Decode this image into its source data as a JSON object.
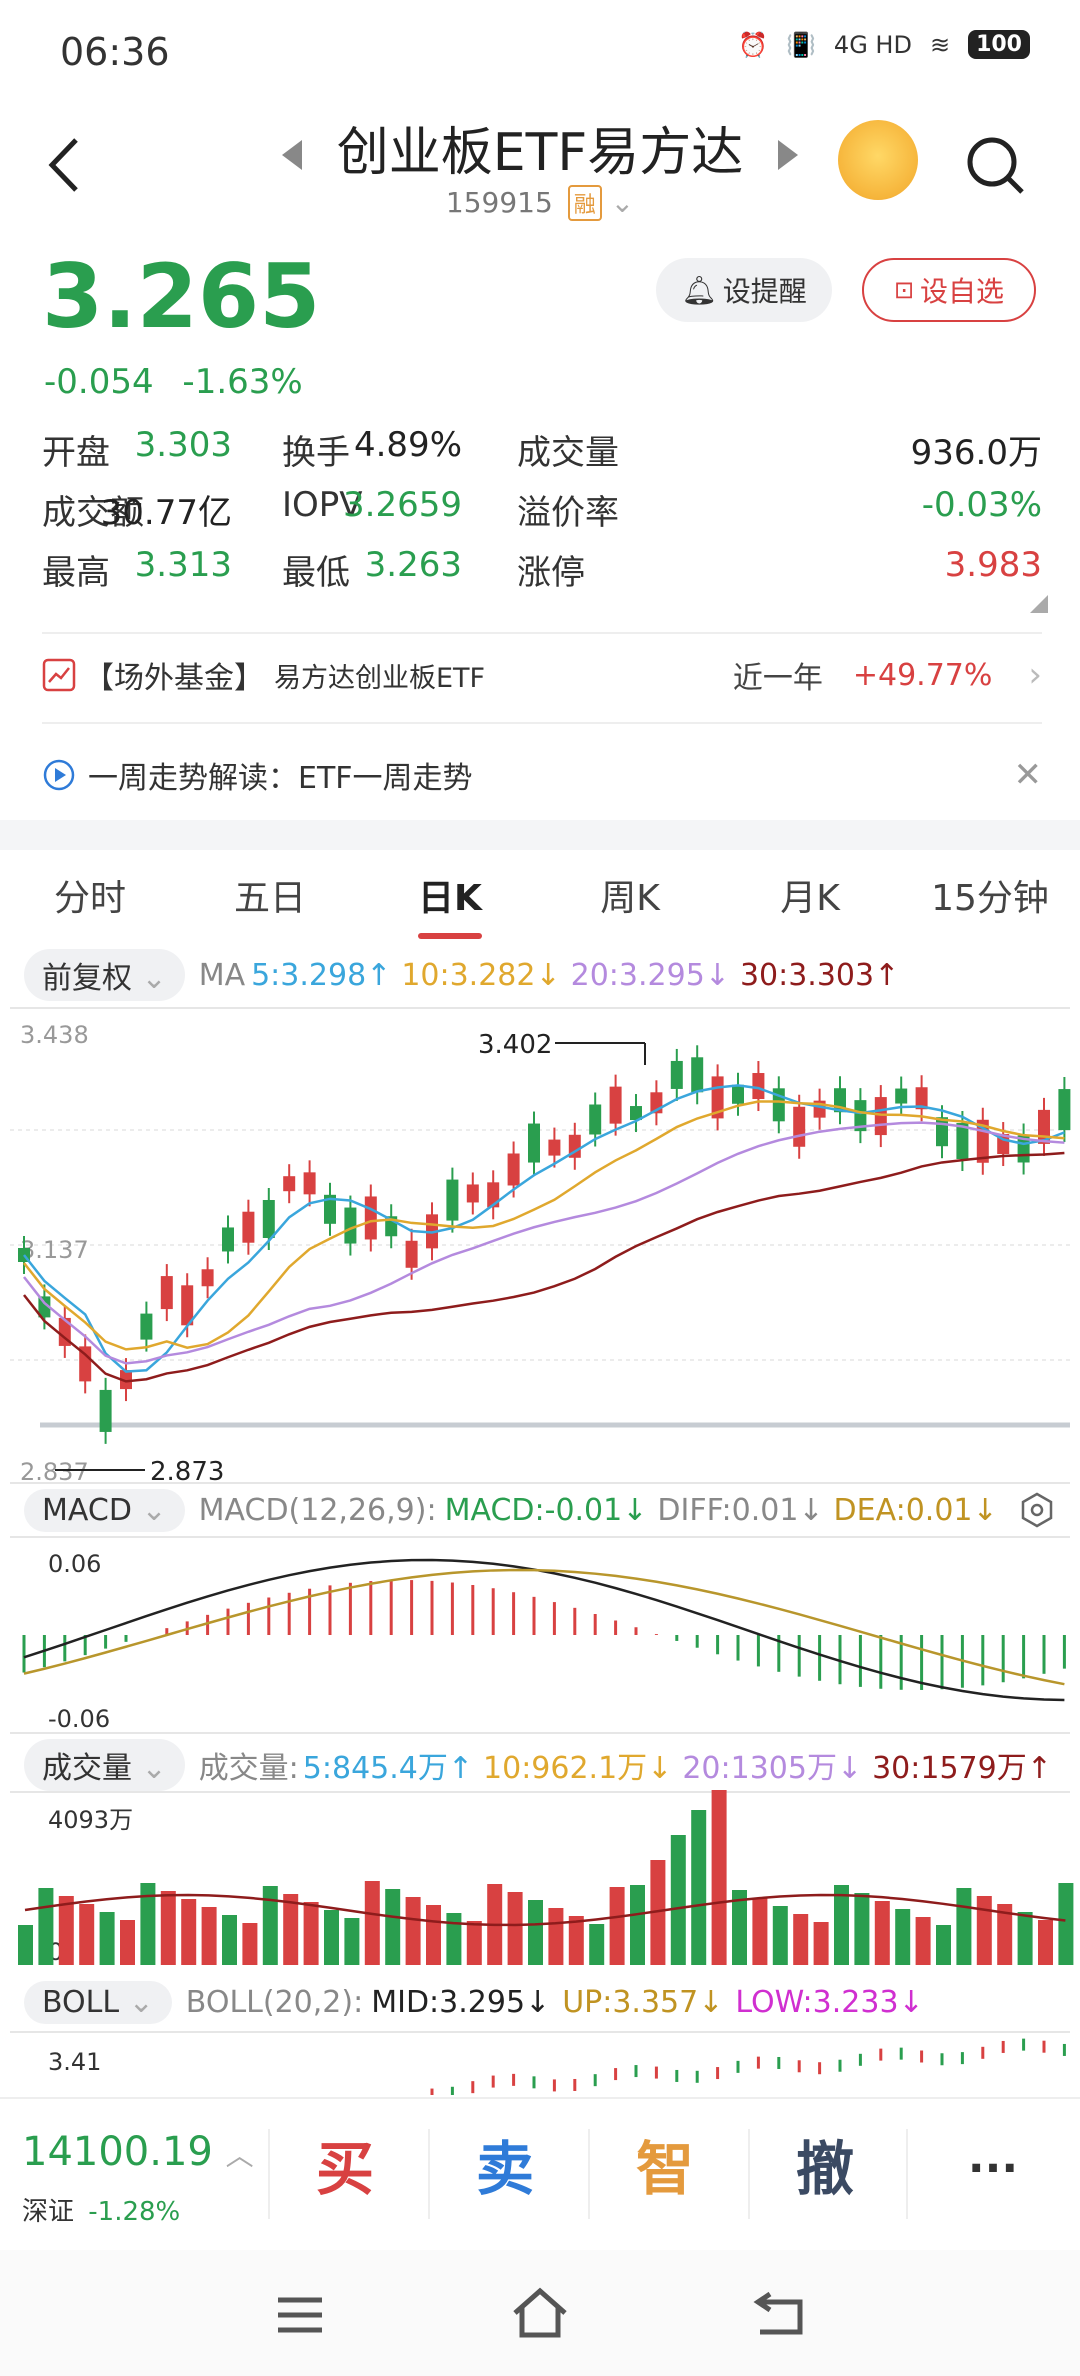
{
  "status": {
    "time": "06:36",
    "network": "4G HD",
    "battery": "100"
  },
  "header": {
    "title": "创业板ETF易方达",
    "code": "159915",
    "margin_tag": "融"
  },
  "quote": {
    "price": "3.265",
    "change": "-0.054",
    "change_pct": "-1.63%",
    "alert_label": "设提醒",
    "fav_label": "设自选"
  },
  "stats": [
    [
      {
        "label": "开盘",
        "value": "3.303",
        "tone": "g"
      },
      {
        "label": "换手",
        "value": "4.89%",
        "tone": "k"
      },
      {
        "label": "成交量",
        "value": "936.0万",
        "tone": "k"
      }
    ],
    [
      {
        "label": "成交额",
        "value": "30.77亿",
        "tone": "k"
      },
      {
        "label": "IOPV",
        "value": "3.2659",
        "tone": "g"
      },
      {
        "label": "溢价率",
        "value": "-0.03%",
        "tone": "g"
      }
    ],
    [
      {
        "label": "最高",
        "value": "3.313",
        "tone": "g"
      },
      {
        "label": "最低",
        "value": "3.263",
        "tone": "g"
      },
      {
        "label": "涨停",
        "value": "3.983",
        "tone": "r"
      }
    ]
  ],
  "otc": {
    "label": "【场外基金】",
    "name": "易方达创业板ETF",
    "period": "近一年",
    "return": "+49.77%"
  },
  "weekly": {
    "text": "一周走势解读：ETF一周走势"
  },
  "tabs": [
    "分时",
    "五日",
    "日K",
    "周K",
    "月K",
    "15分钟"
  ],
  "ma": {
    "adjust": "前复权",
    "prefix": "MA",
    "ma5": "5:3.298↑",
    "ma10": "10:3.282↓",
    "ma20": "20:3.295↓",
    "ma30": "30:3.303↑"
  },
  "kline": {
    "y_top": "3.438",
    "y_mid": "3.137",
    "y_bottom": "2.837",
    "high_label": "3.402",
    "low_label": "2.873"
  },
  "macd": {
    "name": "MACD",
    "params": "MACD(12,26,9):",
    "macd": "MACD:-0.01↓",
    "diff": "DIFF:0.01↓",
    "dea": "DEA:0.01↓",
    "y_top": "0.06",
    "y_bottom": "-0.06"
  },
  "volume": {
    "name": "成交量",
    "prefix": "成交量:",
    "v5": "5:845.4万↑",
    "v10": "10:962.1万↓",
    "v20": "20:1305万↓",
    "v30": "30:1579万↑",
    "y_top": "4093万",
    "y_bottom": "0"
  },
  "boll": {
    "name": "BOLL",
    "params": "BOLL(20,2):",
    "mid": "MID:3.295↓",
    "up": "UP:3.357↓",
    "low": "LOW:3.233↓",
    "y_top": "3.41"
  },
  "bottom": {
    "index_value": "14100.19",
    "index_name": "深证",
    "index_change": "-1.28%",
    "buy": "买",
    "sell": "卖",
    "smart": "智",
    "cancel": "撤",
    "more": "···"
  },
  "colors": {
    "up": "#d84141",
    "down": "#2a9e4f",
    "ma5": "#3aa6dc",
    "ma10": "#e0a82e",
    "ma20": "#b48ade",
    "ma30": "#8e1c1c"
  }
}
